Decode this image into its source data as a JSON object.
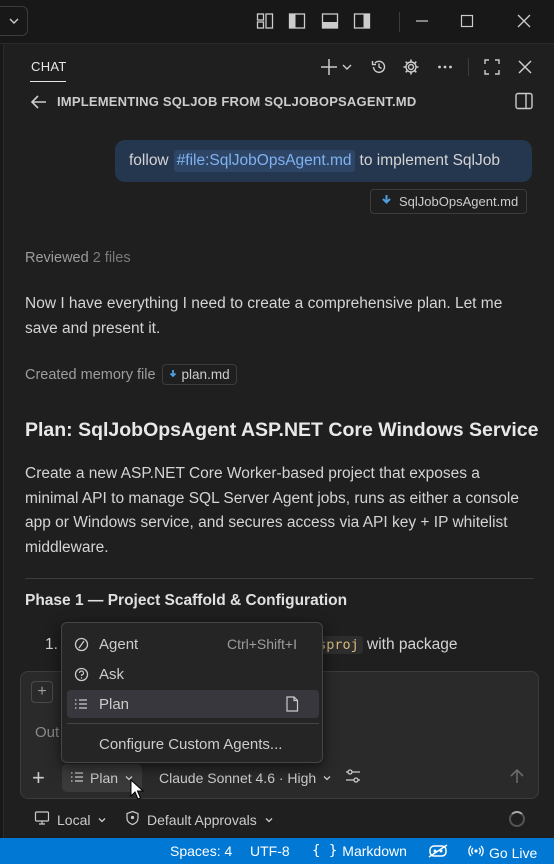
{
  "chat": {
    "tab_label": "CHAT",
    "session_title": "IMPLEMENTING SQLJOB FROM SQLJOBOPSAGENT.MD"
  },
  "user_message": {
    "before": "follow",
    "file_ref": "#file:SqlJobOpsAgent.md",
    "after": "to implement SqlJob",
    "attachment": "SqlJobOpsAgent.md"
  },
  "response": {
    "reviewed_label": "Reviewed",
    "reviewed_count": "2 files",
    "intro": "Now I have everything I need to create a comprehensive plan. Let me save and present it.",
    "memory_label": "Created memory file",
    "memory_file": "plan.md",
    "heading": "Plan: SqlJobOpsAgent ASP.NET Core Windows Service",
    "summary": "Create a new ASP.NET Core Worker-based project that exposes a minimal API to manage SQL Server Agent jobs, runs as either a console app or Windows service, and secures access via API key + IP whitelist middleware.",
    "phase_heading": "Phase 1 — Project Scaffold & Configuration",
    "item_number": "1.",
    "item_code": "nt.csproj",
    "item_tail": "with package"
  },
  "input": {
    "placeholder": "Out",
    "mode_label": "Plan",
    "model_label": "Claude Sonnet 4.6 · High"
  },
  "mode_menu": {
    "items": [
      {
        "label": "Agent",
        "shortcut": "Ctrl+Shift+I",
        "icon": "agent-icon"
      },
      {
        "label": "Ask",
        "icon": "ask-icon"
      },
      {
        "label": "Plan",
        "icon": "plan-icon",
        "selected": true
      }
    ],
    "configure_label": "Configure Custom Agents..."
  },
  "below_input": {
    "location": "Local",
    "approvals": "Default Approvals"
  },
  "status_bar": {
    "spaces": "Spaces: 4",
    "encoding": "UTF-8",
    "language": "Markdown",
    "go_live": "Go Live"
  },
  "colors": {
    "accent": "#0078d4",
    "bubble": "#25364f",
    "file_link": "#7fb2f0"
  }
}
